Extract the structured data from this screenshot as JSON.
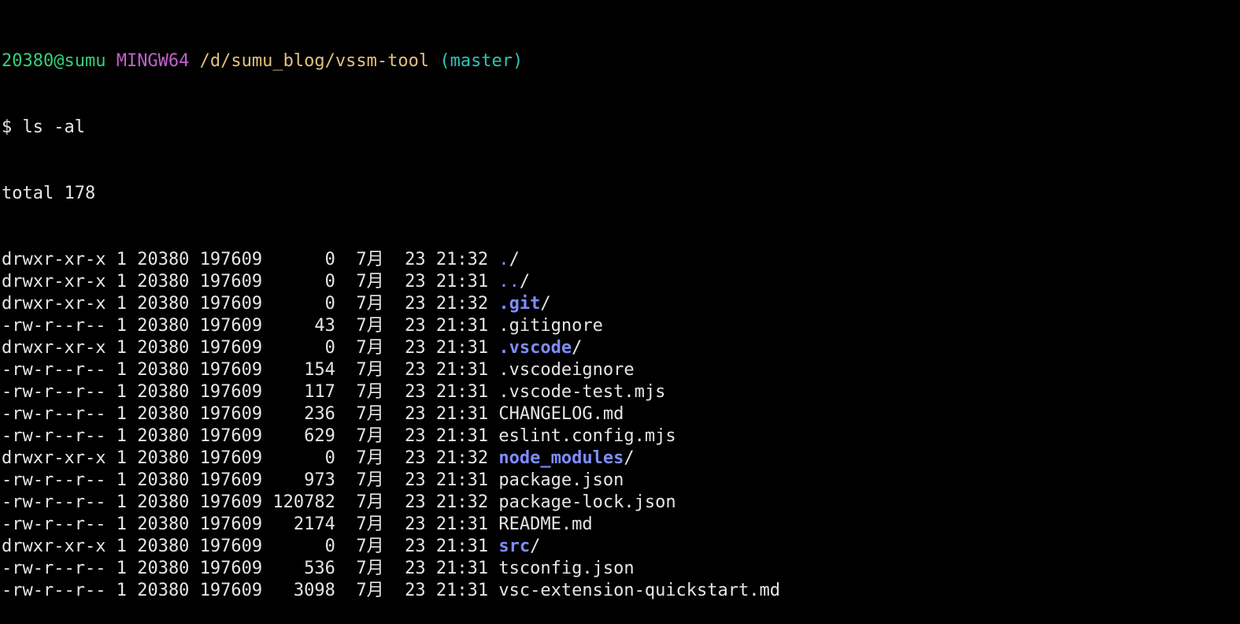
{
  "prompt": {
    "user_host": "20380@sumu",
    "shell": "MINGW64",
    "cwd": "/d/sumu_blog/vssm-tool",
    "branch": "(master)"
  },
  "command": "$ ls -al",
  "total": "total 178",
  "listing": [
    {
      "perms": "drwxr-xr-x",
      "links": "1",
      "owner": "20380",
      "group": "197609",
      "size": "0",
      "month": "7月",
      "day": "23",
      "time": "21:32",
      "name": ".",
      "suffix": "/",
      "kind": "dotdir"
    },
    {
      "perms": "drwxr-xr-x",
      "links": "1",
      "owner": "20380",
      "group": "197609",
      "size": "0",
      "month": "7月",
      "day": "23",
      "time": "21:31",
      "name": "..",
      "suffix": "/",
      "kind": "dotdir"
    },
    {
      "perms": "drwxr-xr-x",
      "links": "1",
      "owner": "20380",
      "group": "197609",
      "size": "0",
      "month": "7月",
      "day": "23",
      "time": "21:32",
      "name": ".git",
      "suffix": "/",
      "kind": "dir"
    },
    {
      "perms": "-rw-r--r--",
      "links": "1",
      "owner": "20380",
      "group": "197609",
      "size": "43",
      "month": "7月",
      "day": "23",
      "time": "21:31",
      "name": ".gitignore",
      "suffix": "",
      "kind": "file"
    },
    {
      "perms": "drwxr-xr-x",
      "links": "1",
      "owner": "20380",
      "group": "197609",
      "size": "0",
      "month": "7月",
      "day": "23",
      "time": "21:31",
      "name": ".vscode",
      "suffix": "/",
      "kind": "dir"
    },
    {
      "perms": "-rw-r--r--",
      "links": "1",
      "owner": "20380",
      "group": "197609",
      "size": "154",
      "month": "7月",
      "day": "23",
      "time": "21:31",
      "name": ".vscodeignore",
      "suffix": "",
      "kind": "file"
    },
    {
      "perms": "-rw-r--r--",
      "links": "1",
      "owner": "20380",
      "group": "197609",
      "size": "117",
      "month": "7月",
      "day": "23",
      "time": "21:31",
      "name": ".vscode-test.mjs",
      "suffix": "",
      "kind": "file"
    },
    {
      "perms": "-rw-r--r--",
      "links": "1",
      "owner": "20380",
      "group": "197609",
      "size": "236",
      "month": "7月",
      "day": "23",
      "time": "21:31",
      "name": "CHANGELOG.md",
      "suffix": "",
      "kind": "file"
    },
    {
      "perms": "-rw-r--r--",
      "links": "1",
      "owner": "20380",
      "group": "197609",
      "size": "629",
      "month": "7月",
      "day": "23",
      "time": "21:31",
      "name": "eslint.config.mjs",
      "suffix": "",
      "kind": "file"
    },
    {
      "perms": "drwxr-xr-x",
      "links": "1",
      "owner": "20380",
      "group": "197609",
      "size": "0",
      "month": "7月",
      "day": "23",
      "time": "21:32",
      "name": "node_modules",
      "suffix": "/",
      "kind": "dir"
    },
    {
      "perms": "-rw-r--r--",
      "links": "1",
      "owner": "20380",
      "group": "197609",
      "size": "973",
      "month": "7月",
      "day": "23",
      "time": "21:31",
      "name": "package.json",
      "suffix": "",
      "kind": "file"
    },
    {
      "perms": "-rw-r--r--",
      "links": "1",
      "owner": "20380",
      "group": "197609",
      "size": "120782",
      "month": "7月",
      "day": "23",
      "time": "21:32",
      "name": "package-lock.json",
      "suffix": "",
      "kind": "file"
    },
    {
      "perms": "-rw-r--r--",
      "links": "1",
      "owner": "20380",
      "group": "197609",
      "size": "2174",
      "month": "7月",
      "day": "23",
      "time": "21:31",
      "name": "README.md",
      "suffix": "",
      "kind": "file"
    },
    {
      "perms": "drwxr-xr-x",
      "links": "1",
      "owner": "20380",
      "group": "197609",
      "size": "0",
      "month": "7月",
      "day": "23",
      "time": "21:31",
      "name": "src",
      "suffix": "/",
      "kind": "dir"
    },
    {
      "perms": "-rw-r--r--",
      "links": "1",
      "owner": "20380",
      "group": "197609",
      "size": "536",
      "month": "7月",
      "day": "23",
      "time": "21:31",
      "name": "tsconfig.json",
      "suffix": "",
      "kind": "file"
    },
    {
      "perms": "-rw-r--r--",
      "links": "1",
      "owner": "20380",
      "group": "197609",
      "size": "3098",
      "month": "7月",
      "day": "23",
      "time": "21:31",
      "name": "vsc-extension-quickstart.md",
      "suffix": "",
      "kind": "file"
    }
  ],
  "colors": {
    "background": "#000000",
    "text": "#e6e6e6",
    "user_host": "#33d17a",
    "shell": "#c061cb",
    "path": "#e5c07b",
    "branch": "#2ec4b6",
    "directory": "#7f8cff"
  }
}
